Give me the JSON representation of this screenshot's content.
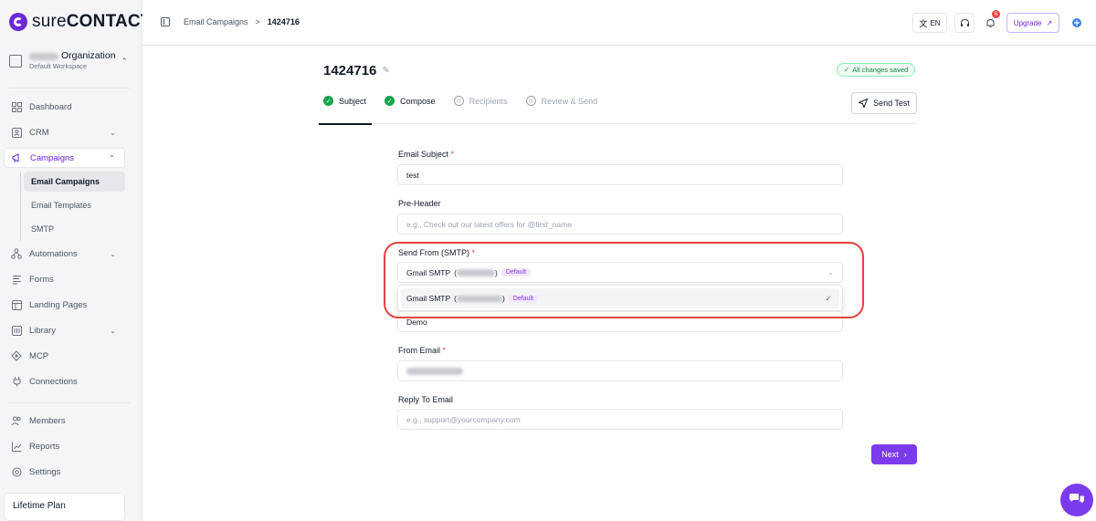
{
  "brand": {
    "logo_bold": "sure",
    "logo_rest": "CONTACT",
    "accent": "#6d28d9"
  },
  "org": {
    "name": "Organization",
    "workspace": "Default Workspace"
  },
  "nav": {
    "dashboard": "Dashboard",
    "crm": "CRM",
    "campaigns": "Campaigns",
    "email_campaigns": "Email Campaigns",
    "email_templates": "Email Templates",
    "smtp": "SMTP",
    "automations": "Automations",
    "forms": "Forms",
    "landing_pages": "Landing Pages",
    "library": "Library",
    "mcp": "MCP",
    "connections": "Connections",
    "members": "Members",
    "reports": "Reports",
    "settings": "Settings"
  },
  "plan": "Lifetime Plan",
  "topbar": {
    "breadcrumb_parent": "Email Campaigns",
    "breadcrumb_sep": ">",
    "breadcrumb_current": "1424716",
    "lang": "EN",
    "notifications_count": "6",
    "upgrade": "Upgrade"
  },
  "campaign": {
    "title": "1424716",
    "saved_status": "All changes saved",
    "send_test": "Send Test",
    "steps": [
      {
        "label": "Subject",
        "done": true
      },
      {
        "label": "Compose",
        "done": true
      },
      {
        "label": "Recipients",
        "done": false
      },
      {
        "label": "Review & Send",
        "done": false
      }
    ]
  },
  "form": {
    "subject_label": "Email Subject",
    "subject_value": "test",
    "preheader_label": "Pre-Header",
    "preheader_placeholder": "e.g., Check out our latest offers for @first_name",
    "send_from_label": "Send From (SMTP)",
    "send_from_value": "Gmail SMTP",
    "default_tag": "Default",
    "dropdown_option": "Gmail SMTP",
    "from_name_value": "Demo",
    "from_email_label": "From Email",
    "reply_to_label": "Reply To Email",
    "reply_to_placeholder": "e.g., support@yourcompany.com",
    "required_mark": "*",
    "next_label": "Next"
  }
}
